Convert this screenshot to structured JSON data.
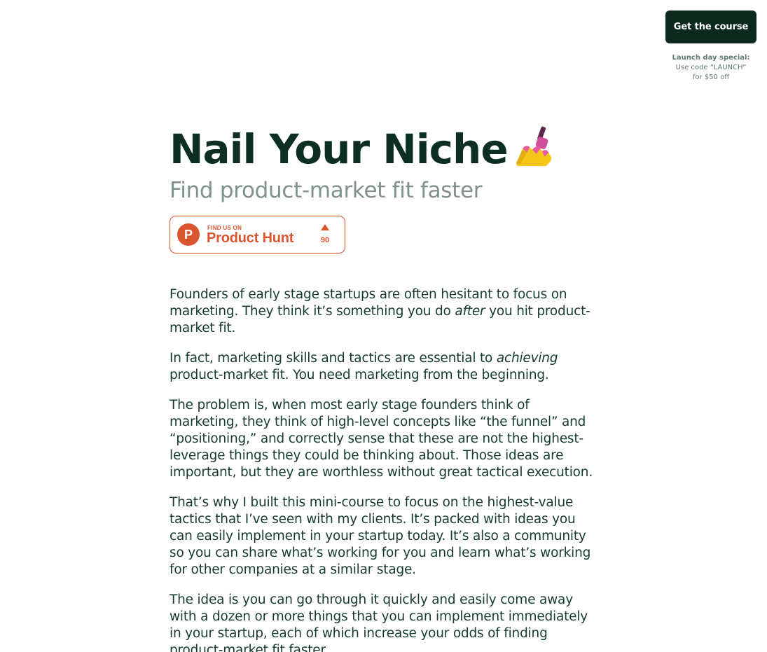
{
  "cta": {
    "label": "Get the course"
  },
  "promo": {
    "title": "Launch day special:",
    "line1": "Use code “LAUNCH”",
    "line2": "for $50 off"
  },
  "hero": {
    "title": "Nail Your Niche",
    "title_icon": "nail-polish-emoji",
    "subtitle": "Find product-market fit faster"
  },
  "product_hunt": {
    "find_text": "FIND US ON",
    "name": "Product Hunt",
    "logo_letter": "P",
    "upvotes": "90",
    "brand_color": "#da552f"
  },
  "paragraphs": {
    "p1": {
      "before": "Founders of early stage startups are often hesitant to focus on marketing. They think it’s something you do ",
      "emph": "after",
      "after": " you hit product-market fit."
    },
    "p2": {
      "before": "In fact, marketing skills and tactics are essential to ",
      "emph": "achieving",
      "after": " product-market fit. You need marketing from the beginning."
    },
    "p3": "The problem is, when most early stage founders think of marketing, they think of high-level concepts like “the funnel” and “positioning,” and correctly sense that these are not the highest-leverage things they could be thinking about. Those ideas are important, but they are worthless without great tactical execution.",
    "p4": "That’s why I built this mini-course to focus on the highest-value tactics that I’ve seen with my clients. It’s packed with ideas you can easily implement in your startup today. It’s also a community so you can share what’s working for you and learn what’s working for other companies at a similar stage.",
    "p5": "The idea is you can go through it quickly and easily come away with a dozen or more things that you can implement immediately in your startup, each of which increase your odds of finding product-market fit faster."
  },
  "colors": {
    "heading": "#0d2f22",
    "subtitle": "#7f9389",
    "cta_background": "#0b2a1d",
    "body_text": "#173b2d"
  }
}
